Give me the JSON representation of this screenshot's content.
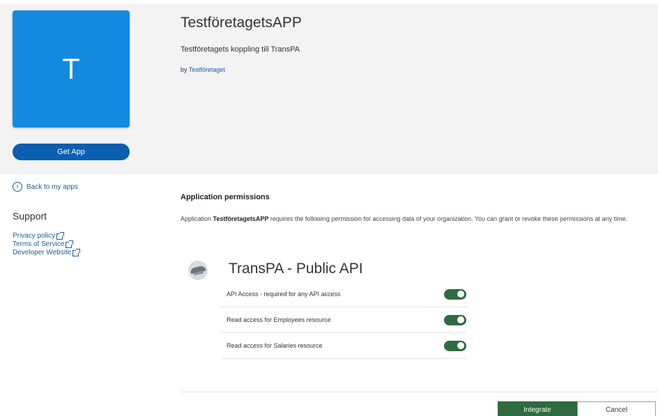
{
  "app": {
    "tile_letter": "T",
    "get_app_label": "Get App",
    "title": "TestföretagetsAPP",
    "description": "Testföretagets koppling till TransPA",
    "by_prefix": "by",
    "publisher": "Testföretaget"
  },
  "sidebar": {
    "back_label": "Back to my apps",
    "back_icon": "chevron-left-circle-icon",
    "support_title": "Support",
    "links": [
      {
        "label": "Privacy policy",
        "icon": "external-link-icon"
      },
      {
        "label": "Terms of Service",
        "icon": "external-link-icon"
      },
      {
        "label": "Developer Website",
        "icon": "external-link-icon"
      }
    ]
  },
  "permissions": {
    "heading": "Application permissions",
    "text_before": "Application ",
    "text_app": "TestföretagetsAPP",
    "text_after": " requires the following permission for accessing data of your organization. You can grant or revoke these permissions at any time.",
    "api_name": "TransPA - Public API",
    "items": [
      {
        "label": "API Access - required for any API access",
        "enabled": true
      },
      {
        "label": "Read access for Employees resource",
        "enabled": true
      },
      {
        "label": "Read access for Salaries resource",
        "enabled": true
      }
    ]
  },
  "actions": {
    "integrate_label": "Integrate",
    "cancel_label": "Cancel"
  },
  "colors": {
    "tile": "#1389e0",
    "get_app": "#0a5fb0",
    "link": "#1a5b9a",
    "toggle_on": "#2e6b3f",
    "integrate": "#2e6b3f"
  }
}
